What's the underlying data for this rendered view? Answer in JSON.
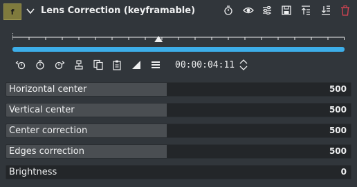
{
  "effect": {
    "badge": "f",
    "title": "Lens Correction  (keyframable)"
  },
  "header_icons": [
    "keyframe-timer-icon",
    "eye-icon",
    "settings-sliders-icon",
    "save-icon",
    "move-up-icon",
    "move-down-icon",
    "trash-icon"
  ],
  "toolbar": {
    "icons": [
      "previous-keyframe-icon",
      "add-keyframe-icon",
      "next-keyframe-icon",
      "align-center-icon",
      "copy-icon",
      "paste-icon",
      "interpolation-icon",
      "menu-icon"
    ],
    "timecode": "00:00:04:11"
  },
  "playhead": {
    "position_fraction": 0.44
  },
  "params": [
    {
      "label": "Horizontal center",
      "value": "500",
      "fill_fraction": 0.465
    },
    {
      "label": "Vertical center",
      "value": "500",
      "fill_fraction": 0.465
    },
    {
      "label": "Center correction",
      "value": "500",
      "fill_fraction": 0.465
    },
    {
      "label": "Edges correction",
      "value": "500",
      "fill_fraction": 0.465
    },
    {
      "label": "Brightness",
      "value": "0",
      "fill_fraction": 0.0
    }
  ],
  "colors": {
    "accent": "#3daee9",
    "badge": "#7f7a3d",
    "delete": "#da4453",
    "background": "#31363b"
  }
}
